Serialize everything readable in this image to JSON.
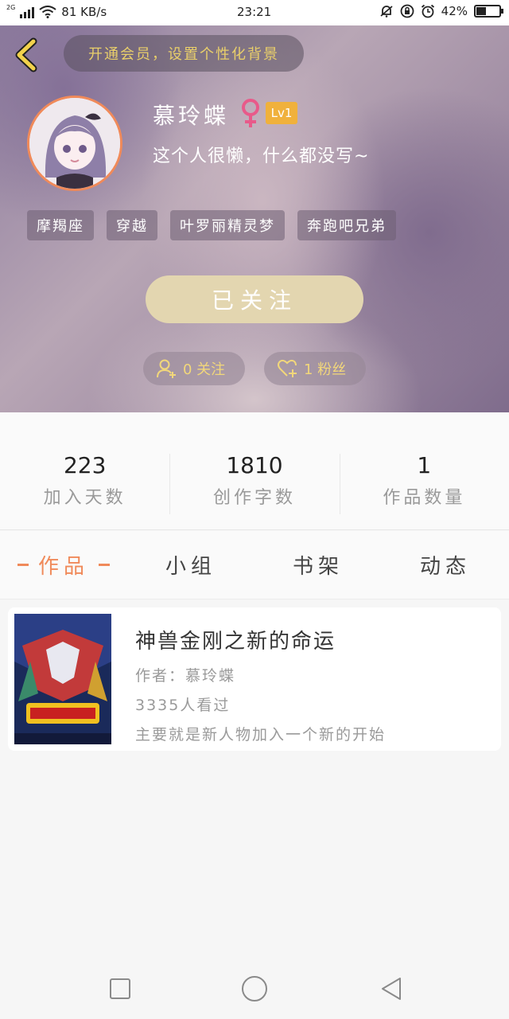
{
  "status_bar": {
    "network": "2G",
    "speed": "81 KB/s",
    "time": "23:21",
    "battery": "42%"
  },
  "header": {
    "vip_prompt": "开通会员，设置个性化背景",
    "username": "慕玲蝶",
    "level": "Lv1",
    "bio": "这个人很懒，什么都没写~",
    "tags": [
      "摩羯座",
      "穿越",
      "叶罗丽精灵梦",
      "奔跑吧兄弟"
    ],
    "follow_button": "已关注",
    "follows_label": "0 关注",
    "fans_label": "1 粉丝"
  },
  "stats": [
    {
      "value": "223",
      "label": "加入天数"
    },
    {
      "value": "1810",
      "label": "创作字数"
    },
    {
      "value": "1",
      "label": "作品数量"
    }
  ],
  "tabs": [
    {
      "label": "作品",
      "active": true
    },
    {
      "label": "小组",
      "active": false
    },
    {
      "label": "书架",
      "active": false
    },
    {
      "label": "动态",
      "active": false
    }
  ],
  "works": [
    {
      "title": "神兽金刚之新的命运",
      "author": "作者：慕玲蝶",
      "views": "3335人看过",
      "summary": "主要就是新人物加入一个新的开始"
    }
  ],
  "colors": {
    "accent": "#f08a5a",
    "gold_text": "#f2d77a",
    "follow_button": "#e3d6b0",
    "level_badge": "#f0b13c"
  },
  "icons": [
    "back-arrow-icon",
    "female-icon",
    "add-user-icon",
    "heart-plus-icon",
    "nav-recent-icon",
    "nav-home-icon",
    "nav-back-icon"
  ]
}
